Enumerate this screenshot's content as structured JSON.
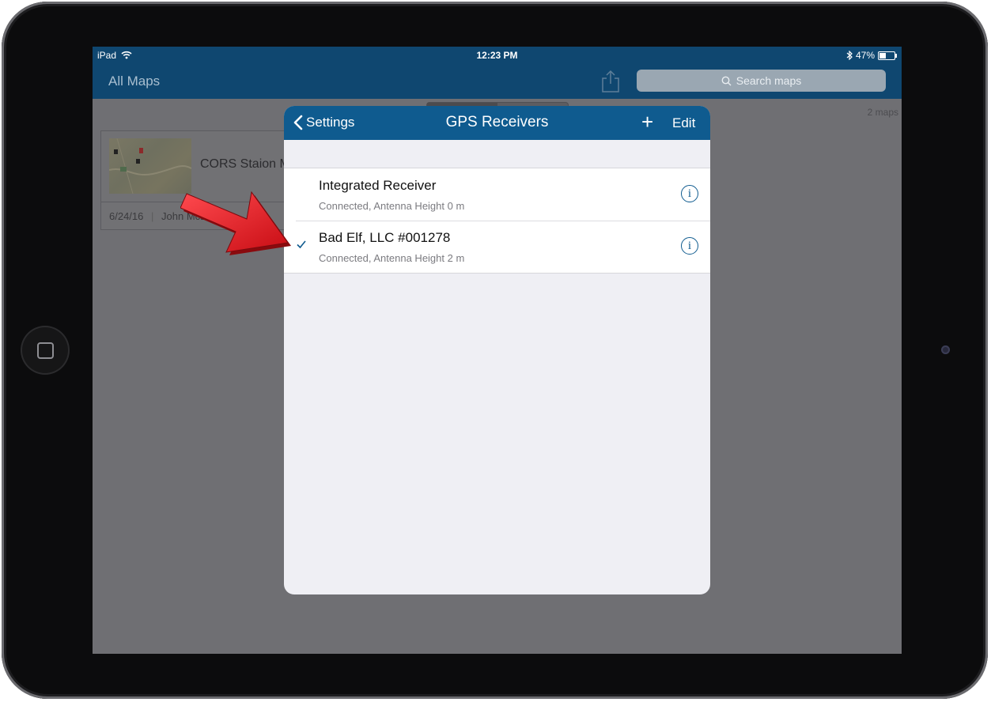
{
  "status": {
    "device": "iPad",
    "time": "12:23 PM",
    "battery": "47%",
    "battery_level": 0.47
  },
  "nav": {
    "title": "All Maps",
    "search_placeholder": "Search maps"
  },
  "content": {
    "map_count": "2 maps",
    "card": {
      "name": "CORS Staion M",
      "date": "6/24/16",
      "author": "John McLe"
    }
  },
  "popover": {
    "back_label": "Settings",
    "title": "GPS Receivers",
    "add_label": "+",
    "edit_label": "Edit",
    "receivers": [
      {
        "name": "Integrated Receiver",
        "detail": "Connected, Antenna Height 0 m",
        "selected": false
      },
      {
        "name": "Bad Elf, LLC #001278",
        "detail": "Connected, Antenna Height 2 m",
        "selected": true
      }
    ]
  },
  "colors": {
    "nav_bar": "#0f4770",
    "popover_nav": "#0f5b8f",
    "accent": "#0f5b8f",
    "arrow": "#e3141b"
  }
}
